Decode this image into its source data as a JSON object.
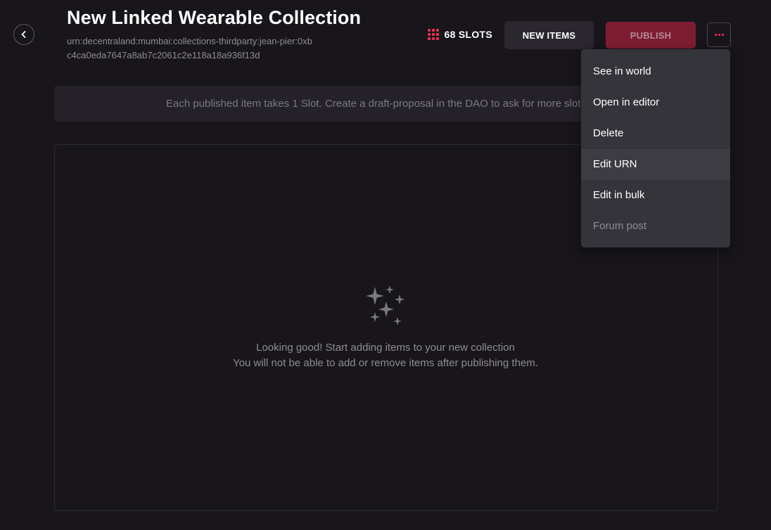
{
  "header": {
    "title": "New Linked Wearable Collection",
    "urn": "urn:decentraland:mumbai:collections-thirdparty:jean-pier:0xbc4ca0eda7647a8ab7c2061c2e118a18a936f13d",
    "slots_label": "68 SLOTS",
    "new_items_label": "NEW ITEMS",
    "publish_label": "PUBLISH"
  },
  "banner": {
    "text": "Each published item takes 1 Slot. Create a draft-proposal in the DAO to ask for more slots."
  },
  "empty_state": {
    "line1": "Looking good! Start adding items to your new collection",
    "line2": "You will not be able to add or remove items after publishing them."
  },
  "menu": {
    "items": [
      {
        "label": "See in world"
      },
      {
        "label": "Open in editor"
      },
      {
        "label": "Delete"
      },
      {
        "label": "Edit URN"
      },
      {
        "label": "Edit in bulk"
      },
      {
        "label": "Forum post"
      }
    ]
  },
  "icons": {
    "back": "chevron-left-icon",
    "slots": "grid-dots-icon",
    "more": "ellipsis-icon",
    "empty": "sparkles-icon"
  },
  "colors": {
    "background": "#18161b",
    "accent": "#ff2d55",
    "publish_bg": "#7d1d34",
    "menu_bg": "#36343b",
    "muted_text": "#8f8c95"
  }
}
